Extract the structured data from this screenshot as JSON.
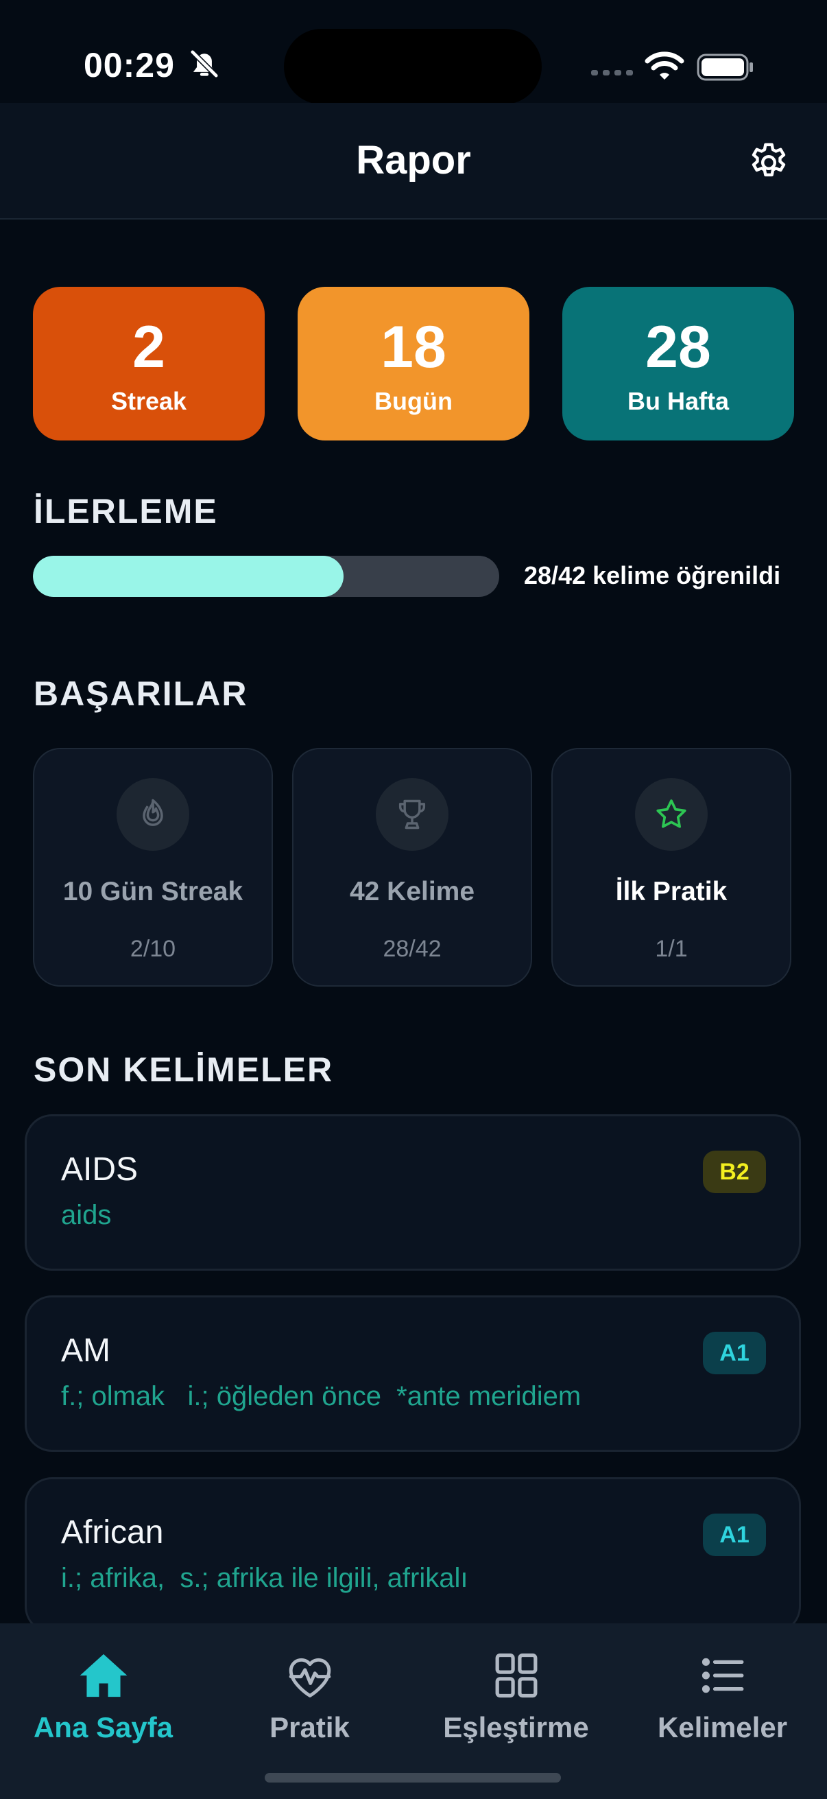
{
  "status_bar": {
    "time": "00:29"
  },
  "header": {
    "title": "Rapor"
  },
  "stats": [
    {
      "value": "2",
      "label": "Streak",
      "color": "#d9500a"
    },
    {
      "value": "18",
      "label": "Bugün",
      "color": "#f2952b"
    },
    {
      "value": "28",
      "label": "Bu Hafta",
      "color": "#087377"
    }
  ],
  "progress": {
    "title": "İLERLEME",
    "text": "28/42 kelime öğrenildi",
    "fraction": 0.6667,
    "fill_color": "#99f5e8"
  },
  "achievements": {
    "title": "BAŞARILAR",
    "items": [
      {
        "icon": "flame-icon",
        "title": "10 Gün Streak",
        "progress": "2/10",
        "unlocked": false
      },
      {
        "icon": "trophy-icon",
        "title": "42 Kelime",
        "progress": "28/42",
        "unlocked": false
      },
      {
        "icon": "star-icon",
        "title": "İlk Pratik",
        "progress": "1/1",
        "unlocked": true
      }
    ]
  },
  "recent_words": {
    "title": "SON KELİMELER",
    "items": [
      {
        "word": "AIDS",
        "meaning": "aids",
        "level": "B2",
        "level_bg": "#3a3a14",
        "level_fg": "#f3ef1f"
      },
      {
        "word": "AM",
        "meaning": "f.; olmak   i.; öğleden önce  *ante meridiem",
        "level": "A1",
        "level_bg": "#0b3f4b",
        "level_fg": "#2fd4de"
      },
      {
        "word": "African",
        "meaning": "i.; afrika,  s.; afrika ile ilgili, afrikalı",
        "level": "A1",
        "level_bg": "#0b3f4b",
        "level_fg": "#2fd4de"
      }
    ]
  },
  "nav": {
    "items": [
      {
        "label": "Ana Sayfa",
        "icon": "home-icon",
        "active": true
      },
      {
        "label": "Pratik",
        "icon": "heart-pulse-icon",
        "active": false
      },
      {
        "label": "Eşleştirme",
        "icon": "grid-icon",
        "active": false
      },
      {
        "label": "Kelimeler",
        "icon": "list-icon",
        "active": false
      }
    ]
  },
  "colors": {
    "accent": "#24c6cb",
    "background": "#040b14"
  }
}
